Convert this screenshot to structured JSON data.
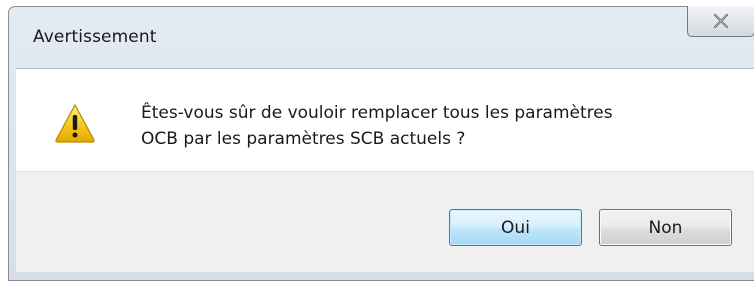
{
  "window": {
    "title": "Avertissement",
    "close_icon": "close-icon"
  },
  "content": {
    "icon": "warning-icon",
    "message_line1": "Êtes-vous sûr de vouloir remplacer tous les paramètres",
    "message_line2": "OCB par les paramètres SCB actuels ?"
  },
  "buttons": {
    "yes_label": "Oui",
    "no_label": "Non"
  },
  "colors": {
    "warning_yellow": "#f5c518",
    "default_button_border": "#3c7fb1"
  }
}
